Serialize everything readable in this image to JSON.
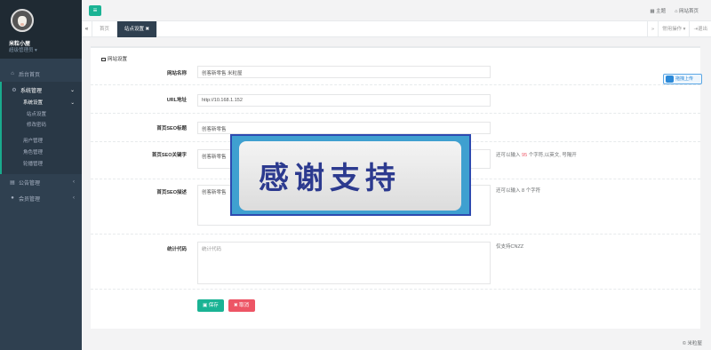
{
  "sidebar": {
    "username": "米粒小屋",
    "role": "超级管理员 ▾",
    "items": [
      {
        "icon": "home-icon",
        "label": "后台首页"
      },
      {
        "icon": "gear-icon",
        "label": "系统管理"
      },
      {
        "icon": "doc-icon",
        "label": "公告管理"
      },
      {
        "icon": "user-icon",
        "label": "会员管理"
      }
    ],
    "sub_title": "系统设置",
    "sub_items": [
      "站点设置",
      "修改密码"
    ],
    "more_items": [
      "用户管理",
      "角色管理",
      "轮播管理"
    ]
  },
  "topbar": {
    "menu_icon": "≡",
    "theme": "主题",
    "site_home": "网站首页"
  },
  "tabs": {
    "home": "首页",
    "active": "站点设置",
    "ops": "常用操作 ▾",
    "logout": "退出"
  },
  "form": {
    "legend": "网站设置",
    "site_name_label": "网站名称",
    "site_name_value": "创客新零售 米粒屋",
    "url_label": "URL地址",
    "url_value": "http://10.168.1.152",
    "seo_title_label": "首页SEO标题",
    "seo_title_value": "创客新零售",
    "seo_keywords_label": "首页SEO关键字",
    "seo_keywords_value": "创客新零售",
    "seo_keywords_help_pre": "还可以输入",
    "seo_keywords_help_count": "95",
    "seo_keywords_help_post": "个字符,以英文, 号隔开",
    "seo_desc_label": "首页SEO描述",
    "seo_desc_value": "创客新零售",
    "seo_desc_help": "还可以输入 8 个字符",
    "stats_label": "统计代码",
    "stats_placeholder": "统计代码",
    "stats_help": "仅支持CNZZ",
    "save": "保存",
    "cancel": "取消"
  },
  "upload_label": "拖拽上传",
  "banner_text": "感谢支持",
  "footer": "© 米粒屋",
  "colors": {
    "accent": "#1ab394",
    "danger": "#ed5565",
    "sidebar": "#2f4050"
  }
}
